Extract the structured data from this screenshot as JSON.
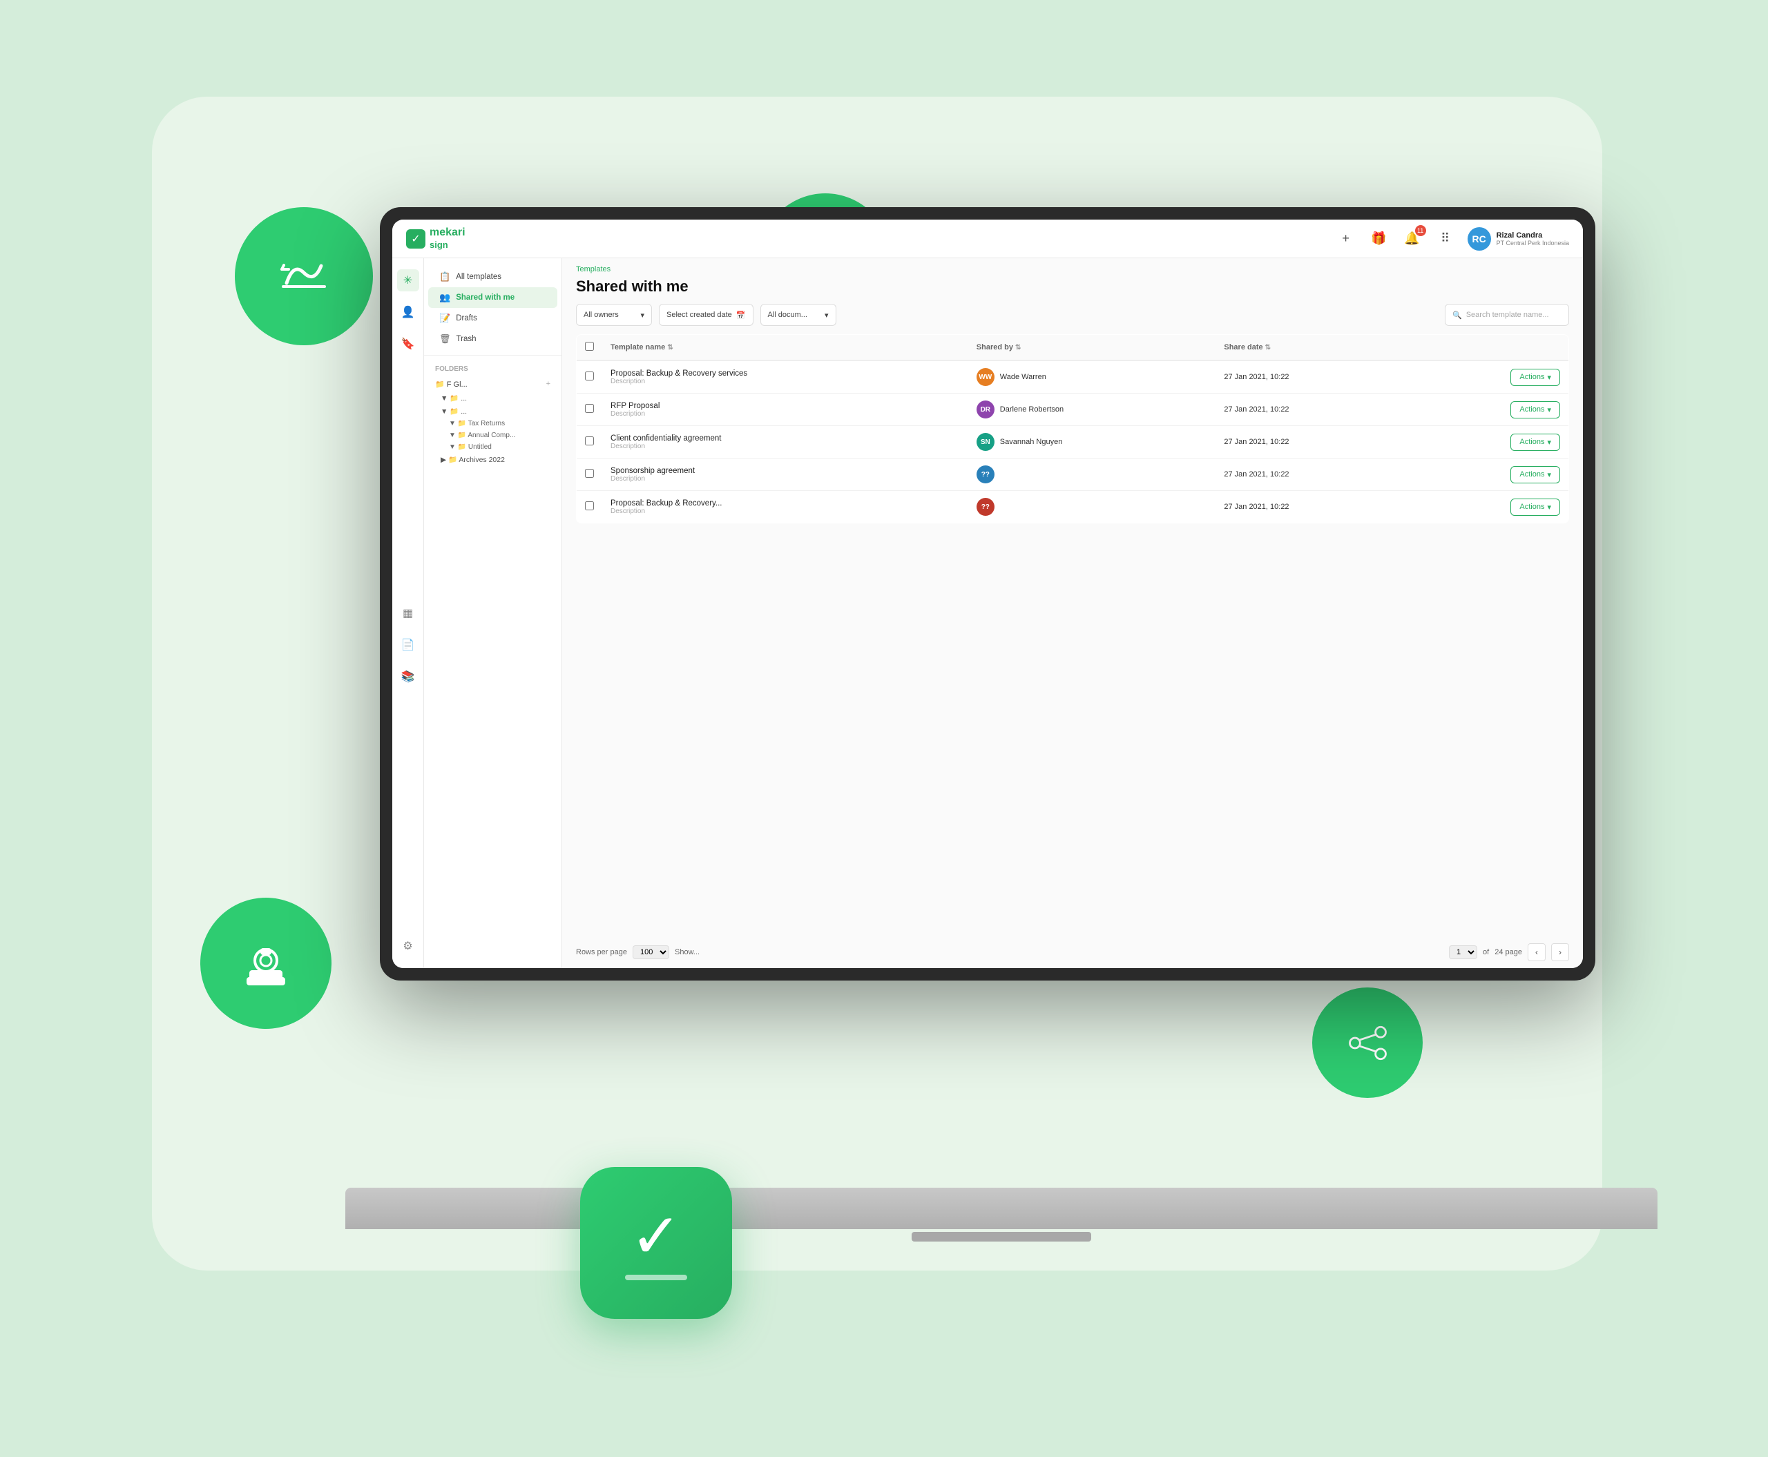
{
  "app": {
    "logo_text": "mekari",
    "logo_sign": "sign",
    "logo_check": "✓"
  },
  "header": {
    "add_btn": "+",
    "notification_count": "11",
    "user_name": "Rizal Candra",
    "user_company": "PT Central Perk Indonesia",
    "user_initials": "RC"
  },
  "sidebar": {
    "templates_label": "Templates",
    "all_templates_label": "All templates",
    "shared_with_me_label": "Shared with me",
    "drafts_label": "Drafts",
    "trash_label": "Trash",
    "folders_label": "FOLDERS",
    "folders": [
      {
        "name": "📁 F Gl...",
        "indent": 0
      },
      {
        "name": "📁 ...",
        "indent": 1
      },
      {
        "name": "📁 ...",
        "indent": 1
      },
      {
        "name": "📁 Tax Returns",
        "indent": 2
      },
      {
        "name": "📁 Annual Comp...",
        "indent": 2
      },
      {
        "name": "📁 Untitled",
        "indent": 2
      },
      {
        "name": "📁 Archives 2022",
        "indent": 1
      }
    ]
  },
  "page": {
    "breadcrumb": "Templates",
    "title": "Shared with me"
  },
  "filters": {
    "owners_label": "All owners",
    "owners_placeholder": "All owners",
    "date_placeholder": "Select created date",
    "documents_label": "All docum...",
    "search_placeholder": "Search template name..."
  },
  "table": {
    "col_template": "Template name",
    "col_shared_by": "Shared by",
    "col_share_date": "Share date",
    "rows": [
      {
        "name": "Proposal: Backup & Recovery services",
        "description": "Description",
        "shared_by": "Wade Warren",
        "avatar_color": "#e67e22",
        "share_date": "27 Jan 2021, 10:22",
        "actions": "Actions"
      },
      {
        "name": "RFP Proposal",
        "description": "Description",
        "shared_by": "Darlene Robertson",
        "avatar_color": "#8e44ad",
        "share_date": "27 Jan 2021, 10:22",
        "actions": "Actions"
      },
      {
        "name": "Client confidentiality agreement",
        "description": "Description",
        "shared_by": "Savannah Nguyen",
        "avatar_color": "#16a085",
        "share_date": "27 Jan 2021, 10:22",
        "actions": "Actions"
      },
      {
        "name": "Sponsorship agreement",
        "description": "Description",
        "shared_by": "",
        "avatar_color": "#2980b9",
        "share_date": "27 Jan 2021, 10:22",
        "actions": "Actions"
      },
      {
        "name": "Proposal: Backup & Recovery...",
        "description": "Description",
        "shared_by": "",
        "avatar_color": "#c0392b",
        "share_date": "27 Jan 2021, 10:22",
        "actions": "Actions"
      }
    ]
  },
  "pagination": {
    "rows_per_page": "Rows per page",
    "rows_value": "100",
    "showing": "Show...",
    "current_page": "1",
    "total_pages": "24 page"
  }
}
